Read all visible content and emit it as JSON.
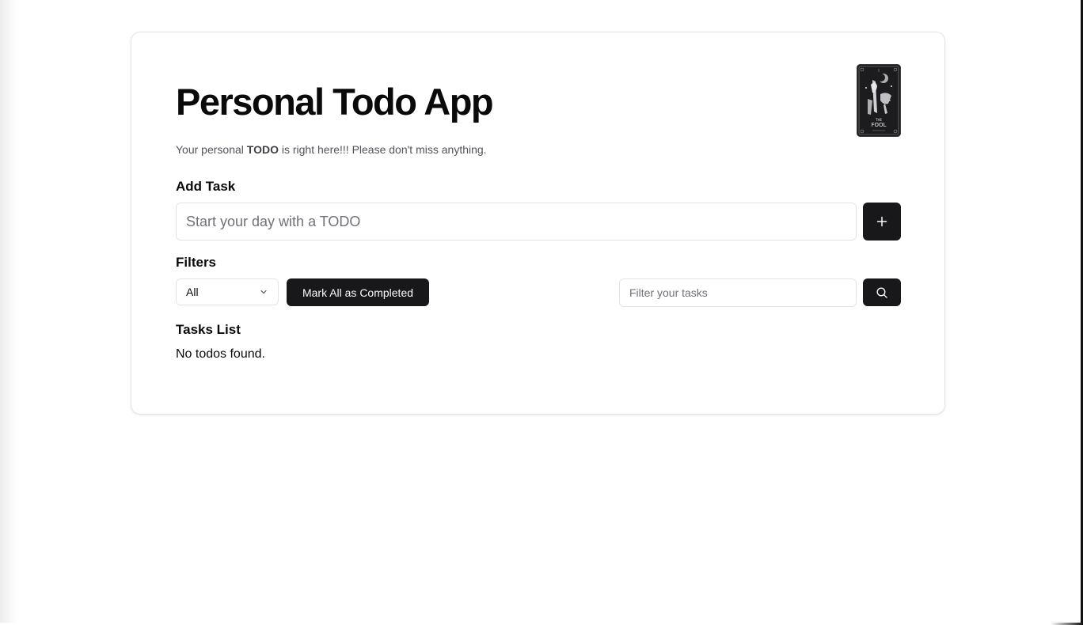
{
  "header": {
    "title": "Personal Todo App",
    "subtitle_prefix": "Your personal ",
    "subtitle_emphasis": "TODO",
    "subtitle_suffix": " is right here!!! Please don't miss anything."
  },
  "add_task": {
    "label": "Add Task",
    "placeholder": "Start your day with a TODO",
    "value": "",
    "button_label": "+"
  },
  "filters": {
    "label": "Filters",
    "status_selected": "All",
    "mark_all_label": "Mark All as Completed",
    "search_placeholder": "Filter your tasks",
    "search_value": ""
  },
  "tasks": {
    "label": "Tasks List",
    "empty_message": "No todos found.",
    "items": []
  },
  "icons": {
    "tarot": "tarot-card-the-fool-icon",
    "add": "plus-icon",
    "chevron": "chevron-down-icon",
    "search": "search-icon"
  },
  "colors": {
    "primary": "#18181b",
    "primary_text": "#fafafa",
    "border": "#e4e4e7",
    "muted_text": "#71717a"
  }
}
